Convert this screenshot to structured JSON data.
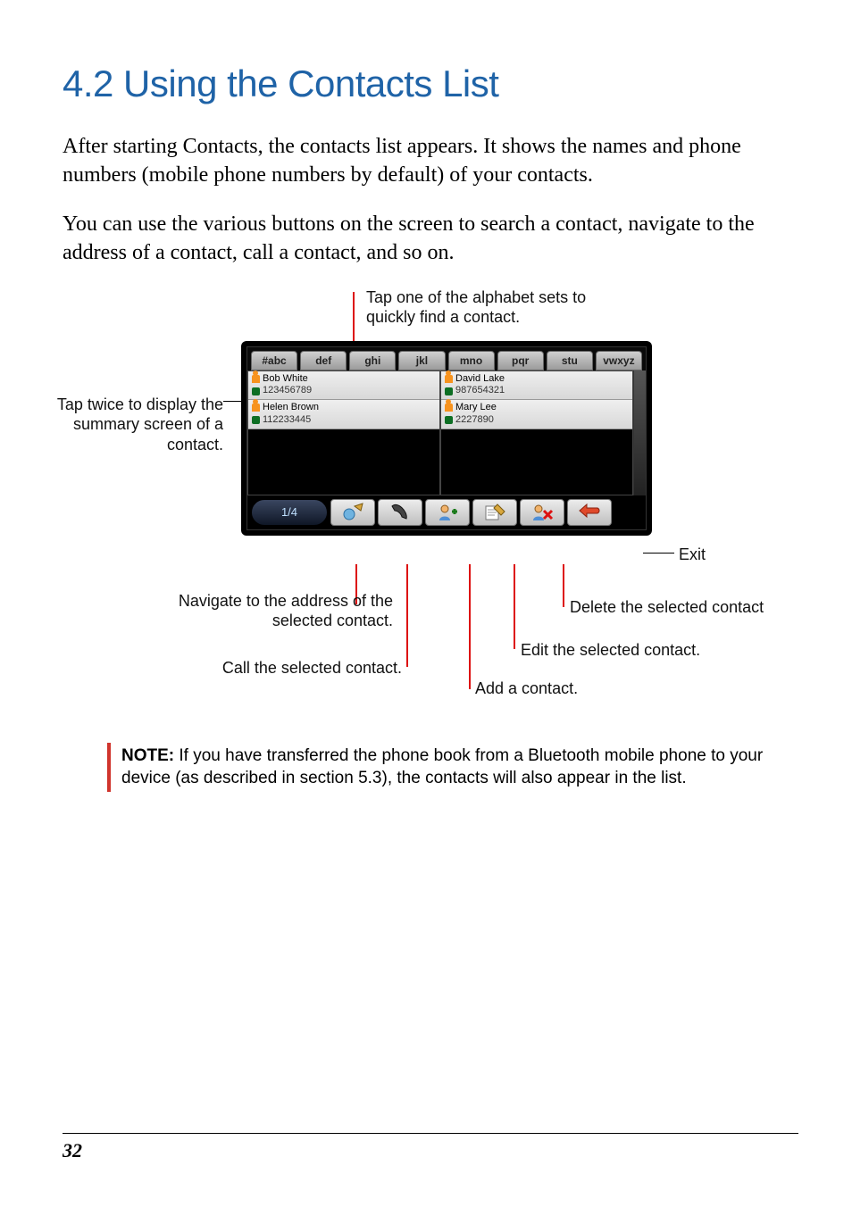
{
  "heading": "4.2   Using the Contacts List",
  "paragraphs": [
    "After starting Contacts, the contacts list appears. It shows the names and phone numbers (mobile phone numbers by default) of your contacts.",
    "You can use the various buttons on the screen to search a contact, navigate to the address of a contact, call a contact, and so on."
  ],
  "callouts": {
    "alphabet": "Tap one of the alphabet sets to quickly find a contact.",
    "summary": "Tap twice to display the summary screen of a contact.",
    "navigate": "Navigate to the address of the selected contact.",
    "call": "Call the selected contact.",
    "add": "Add a contact.",
    "edit": "Edit the selected contact.",
    "delete": "Delete the selected contact",
    "exit": "Exit"
  },
  "tabs": [
    "#abc",
    "def",
    "ghi",
    "jkl",
    "mno",
    "pqr",
    "stu",
    "vwxyz"
  ],
  "contacts": {
    "left": [
      {
        "name": "Bob White",
        "phone": "123456789"
      },
      {
        "name": "Helen Brown",
        "phone": "112233445"
      }
    ],
    "right": [
      {
        "name": "David Lake",
        "phone": "987654321"
      },
      {
        "name": "Mary Lee",
        "phone": "2227890"
      }
    ]
  },
  "pager": "1/4",
  "note": {
    "label": "NOTE:",
    "text": " If you have transferred the phone book from a Bluetooth mobile phone to your device (as described in section 5.3), the contacts will also appear in the list."
  },
  "pageNumber": "32"
}
